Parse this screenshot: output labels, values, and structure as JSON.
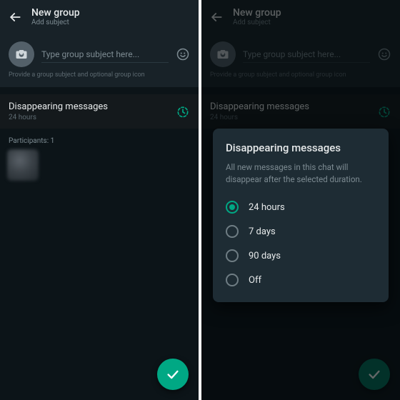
{
  "header": {
    "title": "New group",
    "subtitle": "Add subject"
  },
  "subject": {
    "placeholder": "Type group subject here...",
    "hint": "Provide a group subject and optional group icon"
  },
  "disappearing": {
    "row_title": "Disappearing messages",
    "row_value": "24 hours"
  },
  "participants": {
    "label": "Participants: 1"
  },
  "dialog": {
    "title": "Disappearing messages",
    "description": "All new messages in this chat will disappear after the selected duration.",
    "options": [
      "24 hours",
      "7 days",
      "90 days",
      "Off"
    ],
    "selected": 0
  },
  "colors": {
    "accent": "#00a884",
    "bg": "#0c1418",
    "panel": "#182228",
    "dialog": "#1e2c34"
  }
}
